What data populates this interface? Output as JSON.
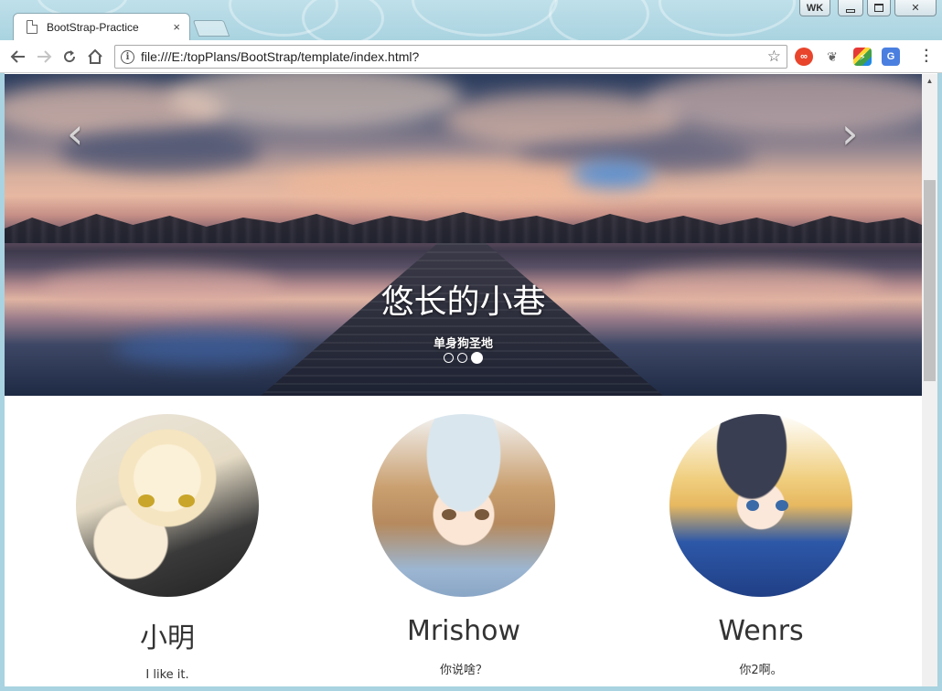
{
  "browser": {
    "tab_title": "BootStrap-Practice",
    "tab_close": "×",
    "url": "file:///E:/topPlans/BootStrap/template/index.html?",
    "window_buttons": [
      "WK",
      "▭",
      "❐",
      "✕"
    ]
  },
  "carousel": {
    "prev": "‹",
    "next": "›",
    "heading": "悠长的小巷",
    "subheading": "单身狗圣地",
    "active_index": 2,
    "slide_count": 3
  },
  "columns": [
    {
      "name": "小明",
      "text": "I like it."
    },
    {
      "name": "Mrishow",
      "text": "你说啥？"
    },
    {
      "name": "Wenrs",
      "text": "你2啊。"
    }
  ]
}
